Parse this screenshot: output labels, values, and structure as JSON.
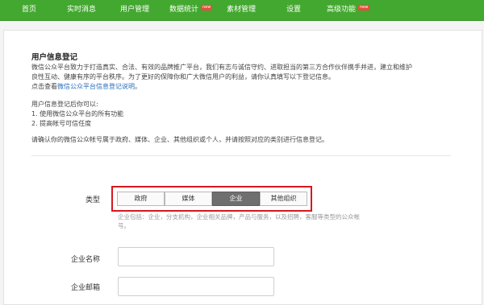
{
  "nav": {
    "items": [
      {
        "label": "首页"
      },
      {
        "label": "实时消息"
      },
      {
        "label": "用户管理"
      },
      {
        "label": "数据统计",
        "badge": "new"
      },
      {
        "label": "素材管理"
      },
      {
        "label": "设置"
      },
      {
        "label": "高级功能",
        "badge": "new"
      }
    ]
  },
  "info": {
    "title": "用户信息登记",
    "intro_line1": "微信公众平台致力于打造真实、合法、有效的品牌推广平台，我们有志与诚信守约、进取担当的第三方合作伙伴携手并进，建立和维护",
    "intro_line2": "良性互动、健康有序的平台秩序。为了更好的保障你和广大微信用户的利益，请你认真填写以下登记信息。",
    "link_prefix": "点击查看",
    "link_text": "微信公众平台信息登记说明",
    "link_suffix": "。",
    "after_title": "用户信息登记后你可以:",
    "benefit_1": "1. 使用微信公众平台的所有功能",
    "benefit_2": "2. 提高帐号可信任度",
    "instruction": "请确认你的微信公众帐号属于政府、媒体、企业、其他组织或个人，并请按照对应的类别进行信息登记。"
  },
  "form": {
    "type_label": "类型",
    "type_options": [
      "政府",
      "媒体",
      "企业",
      "其他组织"
    ],
    "selected_type": "企业",
    "type_hint": "企业包括：企业，分支机构，企业相关品牌，产品与服务，以及招聘，客服等类型的公众帐号。",
    "company_name_label": "企业名称",
    "company_name_value": "",
    "company_email_label": "企业邮箱",
    "company_email_value": ""
  },
  "colors": {
    "nav_bg": "#43a82f",
    "highlight_border": "#d9171f",
    "active_segment": "#6f6f6f",
    "link": "#2a6ebb"
  }
}
